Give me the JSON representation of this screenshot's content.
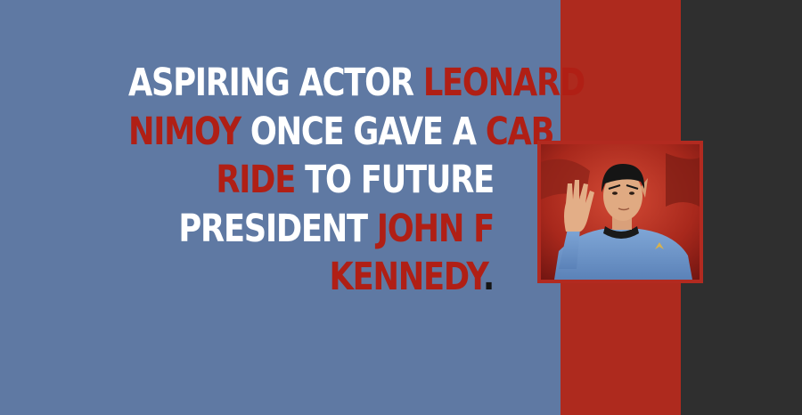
{
  "colors": {
    "blue_panel": "#5f79a3",
    "red_stripe": "#ae2a1e",
    "dark_panel": "#2f2f2f",
    "text_white": "#ffffff",
    "text_highlight": "#b01f15",
    "text_black": "#151515"
  },
  "fact": {
    "lines": [
      [
        {
          "text": "ASPIRING ACTOR ",
          "tone": "white"
        },
        {
          "text": "LEONARD",
          "tone": "highlight"
        }
      ],
      [
        {
          "text": "NIMOY",
          "tone": "highlight"
        },
        {
          "text": " ONCE GAVE A ",
          "tone": "white"
        },
        {
          "text": "CAB",
          "tone": "highlight"
        }
      ],
      [
        {
          "text": "RIDE",
          "tone": "highlight"
        },
        {
          "text": " TO FUTURE",
          "tone": "white"
        }
      ],
      [
        {
          "text": "PRESIDENT ",
          "tone": "white"
        },
        {
          "text": "JOHN F",
          "tone": "highlight"
        }
      ],
      [
        {
          "text": "KENNEDY",
          "tone": "highlight"
        },
        {
          "text": ".",
          "tone": "black"
        }
      ]
    ]
  },
  "photo": {
    "icon": "spock-vulcan-salute-photo"
  }
}
